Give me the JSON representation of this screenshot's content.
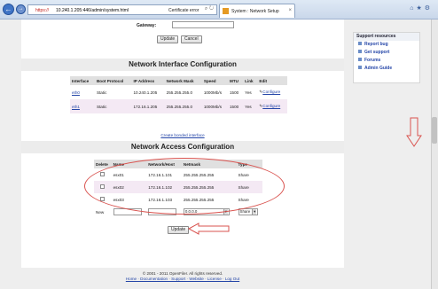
{
  "browser": {
    "protocol": "https://",
    "host": "10.240.1.205:446/admin/system.html",
    "cert_error": "Certificate error",
    "tab_title": "System : Network Setup"
  },
  "form_top": {
    "gateway_label": "Gateway:",
    "update_label": "Update",
    "cancel_label": "Cancel"
  },
  "nic": {
    "title": "Network Interface Configuration",
    "headers": [
      "Interface",
      "Boot Protocol",
      "IP Address",
      "Network Mask",
      "Speed",
      "MTU",
      "Link",
      "Edit"
    ],
    "rows": [
      {
        "iface": "eth0",
        "boot": "Static",
        "ip": "10.240.1.205",
        "mask": "255.255.255.0",
        "speed": "1000Mb/s",
        "mtu": "1500",
        "link": "Yes",
        "edit": "Configure"
      },
      {
        "iface": "eth1",
        "boot": "Static",
        "ip": "172.16.1.205",
        "mask": "255.255.255.0",
        "speed": "1000Mb/s",
        "mtu": "1500",
        "link": "Yes",
        "edit": "Configure"
      }
    ],
    "bonded_link": "Create bonded interface"
  },
  "nac": {
    "title": "Network Access Configuration",
    "headers": [
      "Delete",
      "Name",
      "Network/Host",
      "Netmask",
      "Type"
    ],
    "rows": [
      {
        "name": "esx01",
        "host": "172.16.1.101",
        "mask": "255.255.255.255",
        "type": "Share"
      },
      {
        "name": "esx02",
        "host": "172.16.1.102",
        "mask": "255.255.255.255",
        "type": "Share"
      },
      {
        "name": "esx03",
        "host": "172.16.1.103",
        "mask": "255.255.255.255",
        "type": "Share"
      }
    ],
    "new_label": "New",
    "new_mask_value": "0.0.0.0",
    "new_type_value": "Share",
    "update_label": "Update"
  },
  "sidebar": {
    "title": "Support resources",
    "items": [
      "Report bug",
      "Get support",
      "Forums",
      "Admin Guide"
    ]
  },
  "footer": {
    "copyright": "© 2001 - 2011 OpenFiler. All rights reserved.",
    "links": "Home · Documentation · Support · Website · License · Log Out"
  },
  "colors": {
    "annotation": "#d9534f",
    "link": "#2546a8"
  }
}
